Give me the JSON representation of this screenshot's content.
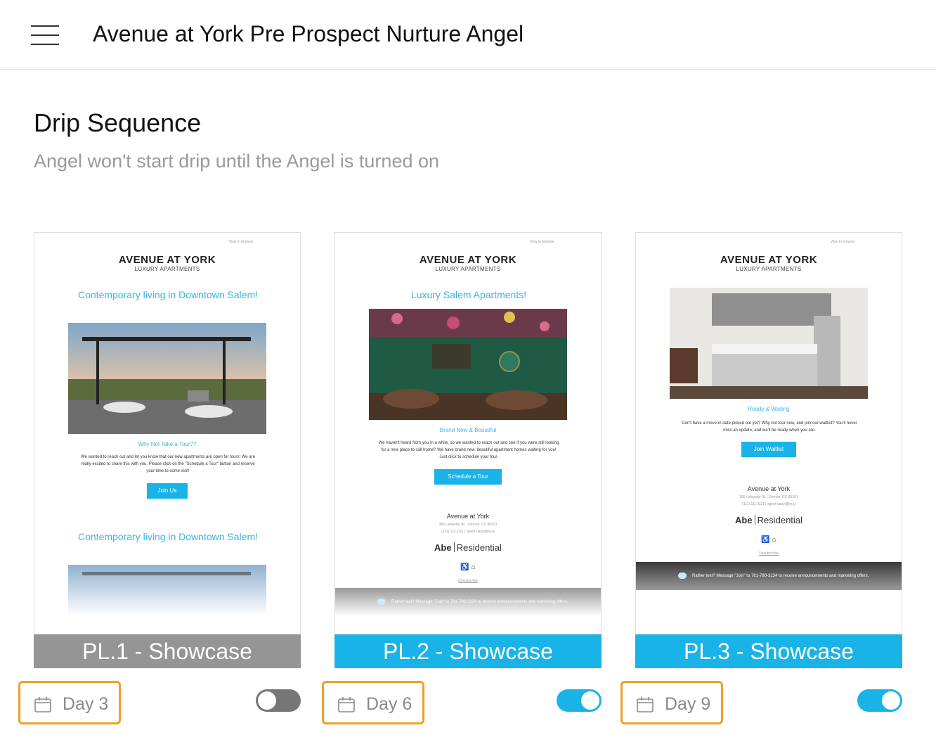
{
  "header": {
    "title": "Avenue at York Pre Prospect Nurture Angel",
    "menu_icon": "hamburger-menu-icon"
  },
  "section": {
    "title": "Drip Sequence",
    "subtitle": "Angel won't start drip until the Angel is turned on"
  },
  "colors": {
    "accent": "#1ab3e8",
    "inactive_label": "#959595",
    "day_highlight": "#f0a028",
    "toggle_off": "#767676"
  },
  "cards": [
    {
      "label": "PL.1 - Showcase",
      "active": false,
      "day": "Day 3",
      "preview": {
        "view_in_browser": "View in browser",
        "brand": "AVENUE AT YORK",
        "brand_sub": "LUXURY APARTMENTS",
        "headline": "Contemporary living in Downtown Salem!",
        "subhead": "Why Not Take a Tour??",
        "body": "We wanted to reach out and let you know that our new apartments are open for tours! We are really excited to share this with you. Please click on the \"Schedule a Tour\" button and reserve your time to come visit!",
        "button": "Join Us",
        "headline_repeat": "Contemporary living in Downtown Salem!"
      }
    },
    {
      "label": "PL.2 - Showcase",
      "active": true,
      "day": "Day 6",
      "preview": {
        "view_in_browser": "View in browser",
        "brand": "AVENUE AT YORK",
        "brand_sub": "LUXURY APARTMENTS",
        "headline": "Luxury Salem Apartments!",
        "subhead": "Brand New & Beautiful",
        "body": "We haven't heard from you in a while, so we wanted to reach out and see if you were still looking for a new place to call home? We have brand new, beautiful apartment homes waiting for you! Just click to schedule your tour.",
        "button": "Schedule a Tour",
        "footer_name": "Avenue at York",
        "footer_addr1": "386 Lafayette St. , Denver, CO 80201",
        "footer_addr2": "(111) 111-1111 | agent-uaay@hy.ly",
        "abe_bold": "Abe",
        "abe_light": "Residential",
        "unsubscribe": "Unsubscribe",
        "text_band": "Rather text? Message \"Join\" to 781-780-3134 to receive announcements and marketing offers."
      }
    },
    {
      "label": "PL.3 - Showcase",
      "active": true,
      "day": "Day 9",
      "preview": {
        "view_in_browser": "View in browser",
        "brand": "AVENUE AT YORK",
        "brand_sub": "LUXURY APARTMENTS",
        "subhead": "Ready & Waiting",
        "body": "Don't have a move-in date picked out yet? Why not tour now, and join our waitlist? You'll never miss an update, and we'll be ready when you are.",
        "button": "Join Waitlist",
        "footer_name": "Avenue at York",
        "footer_addr1": "386 Lafayette St. , Denver, CO 80201",
        "footer_addr2": "(111) 111-1111 | agent-uaay@hy.ly",
        "abe_bold": "Abe",
        "abe_light": "Residential",
        "unsubscribe": "Unsubscribe",
        "text_band": "Rather text? Message \"Join\" to 781-780-3134 to receive announcements and marketing offers."
      }
    }
  ]
}
